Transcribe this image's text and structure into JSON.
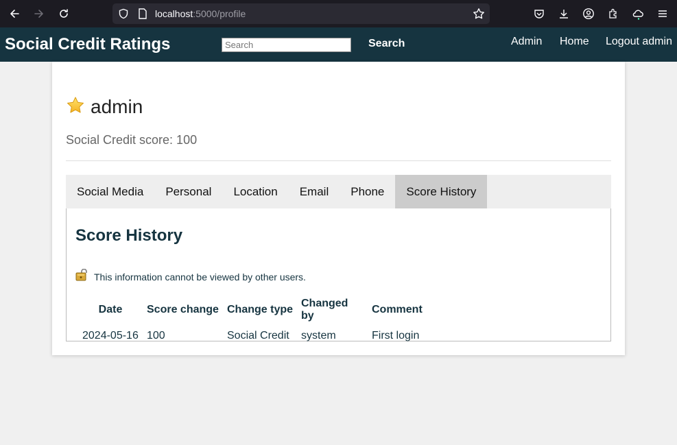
{
  "browser": {
    "url_host": "localhost",
    "url_path": ":5000/profile"
  },
  "header": {
    "site_title": "Social Credit Ratings",
    "search_placeholder": "Search",
    "search_button": "Search",
    "nav": [
      "Admin",
      "Home",
      "Logout admin"
    ]
  },
  "profile": {
    "icon": "star-icon",
    "username": "admin",
    "score_text": "Social Credit score: 100"
  },
  "tabs": [
    {
      "label": "Social Media",
      "active": false
    },
    {
      "label": "Personal",
      "active": false
    },
    {
      "label": "Location",
      "active": false
    },
    {
      "label": "Email",
      "active": false
    },
    {
      "label": "Phone",
      "active": false
    },
    {
      "label": "Score History",
      "active": true
    }
  ],
  "score_history": {
    "title": "Score History",
    "privacy_icon": "lock-icon",
    "privacy_note": "This information cannot be viewed by other users.",
    "columns": [
      "Date",
      "Score change",
      "Change type",
      "Changed by",
      "Comment"
    ],
    "rows": [
      [
        "2024-05-16",
        "100",
        "Social Credit",
        "system",
        "First login"
      ]
    ]
  },
  "colors": {
    "header_bg": "#163440",
    "active_tab": "#cccccc",
    "tab_bar": "#eeeeee",
    "page_bg": "#f0f0f0"
  }
}
